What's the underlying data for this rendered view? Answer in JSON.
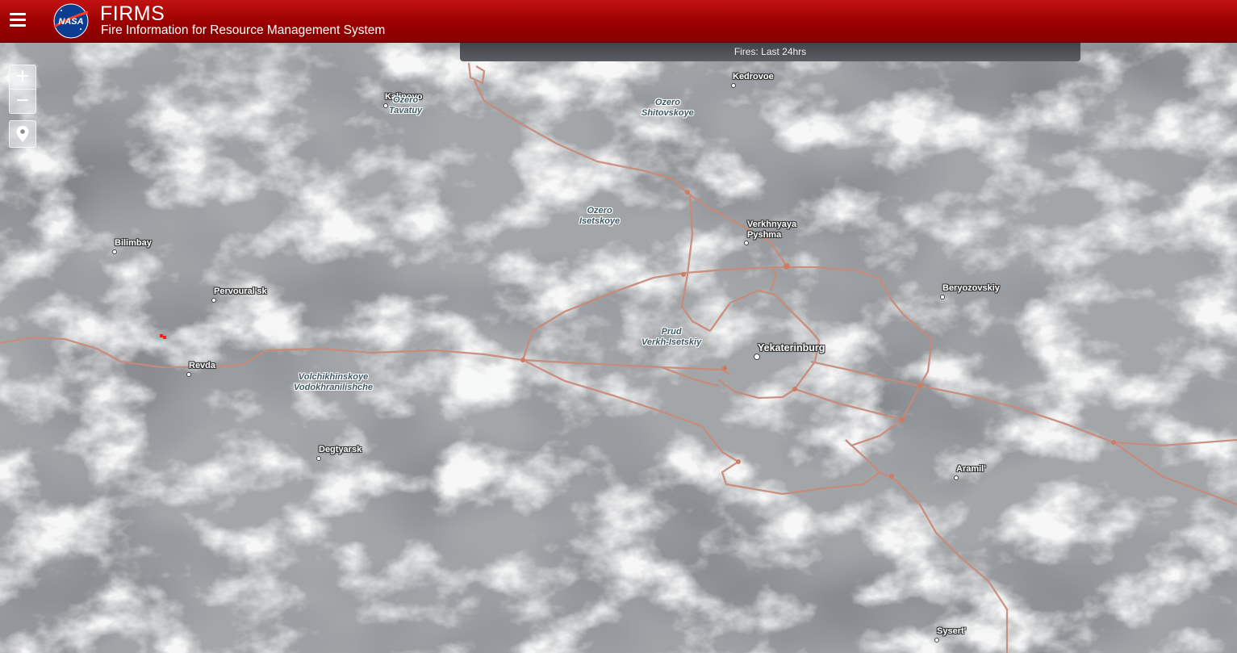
{
  "header": {
    "title": "FIRMS",
    "subtitle": "Fire Information for Resource Management System",
    "logo_text": "NASA"
  },
  "fires_bar": {
    "label": "Fires: Last 24hrs"
  },
  "map_controls": {
    "zoom_in": "+",
    "zoom_out": "−"
  },
  "places": [
    "Kalinovo",
    "Kedrovoe",
    "Bilimbay",
    "Pervoural'sk",
    "Revda",
    "Verkhnyaya",
    "Pyshma",
    "Beryozovskiy",
    "Yekaterinburg",
    "Degtyarsk",
    "Aramil'",
    "Sysert'"
  ],
  "water_bodies": [
    "Ozero\nTavatuy",
    "Ozero\nShitovskoye",
    "Ozero\nIsetskoye",
    "Prud\nVerkh-Isetskiy",
    "Volchikhinskoye\nVodokhranilishche"
  ],
  "colors": {
    "header_red": "#a00000",
    "road": "#c98a78",
    "fire": "#ff1a1a"
  }
}
